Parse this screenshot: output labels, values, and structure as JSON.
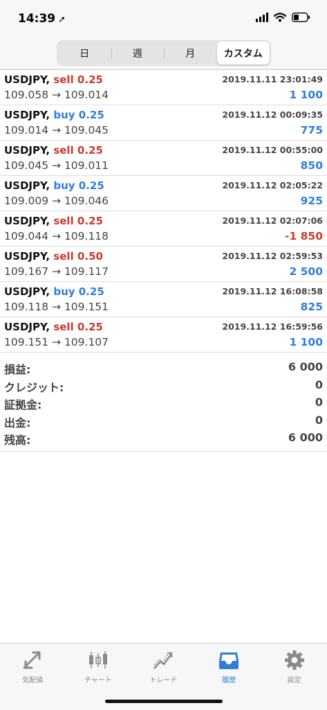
{
  "status_bar": {
    "time": "14:39",
    "location_glyph": "➚"
  },
  "segments": [
    {
      "label": "日",
      "active": false
    },
    {
      "label": "週",
      "active": false
    },
    {
      "label": "月",
      "active": false
    },
    {
      "label": "カスタム",
      "active": true
    }
  ],
  "deals": [
    {
      "symbol": "USDJPY,",
      "side": "sell",
      "side_text": "sell 0.25",
      "time": "2019.11.11 23:01:49",
      "prices": "109.058 → 109.014",
      "profit": "1 100",
      "profit_sign": "pos"
    },
    {
      "symbol": "USDJPY,",
      "side": "buy",
      "side_text": "buy 0.25",
      "time": "2019.11.12 00:09:35",
      "prices": "109.014 → 109.045",
      "profit": "775",
      "profit_sign": "pos"
    },
    {
      "symbol": "USDJPY,",
      "side": "sell",
      "side_text": "sell 0.25",
      "time": "2019.11.12 00:55:00",
      "prices": "109.045 → 109.011",
      "profit": "850",
      "profit_sign": "pos"
    },
    {
      "symbol": "USDJPY,",
      "side": "buy",
      "side_text": "buy 0.25",
      "time": "2019.11.12 02:05:22",
      "prices": "109.009 → 109.046",
      "profit": "925",
      "profit_sign": "pos"
    },
    {
      "symbol": "USDJPY,",
      "side": "sell",
      "side_text": "sell 0.25",
      "time": "2019.11.12 02:07:06",
      "prices": "109.044 → 109.118",
      "profit": "-1 850",
      "profit_sign": "neg"
    },
    {
      "symbol": "USDJPY,",
      "side": "sell",
      "side_text": "sell 0.50",
      "time": "2019.11.12 02:59:53",
      "prices": "109.167 → 109.117",
      "profit": "2 500",
      "profit_sign": "pos"
    },
    {
      "symbol": "USDJPY,",
      "side": "buy",
      "side_text": "buy 0.25",
      "time": "2019.11.12 16:08:58",
      "prices": "109.118 → 109.151",
      "profit": "825",
      "profit_sign": "pos"
    },
    {
      "symbol": "USDJPY,",
      "side": "sell",
      "side_text": "sell 0.25",
      "time": "2019.11.12 16:59:56",
      "prices": "109.151 → 109.107",
      "profit": "1 100",
      "profit_sign": "pos"
    }
  ],
  "summary": [
    {
      "label": "損益:",
      "value": "6 000"
    },
    {
      "label": "クレジット:",
      "value": "0"
    },
    {
      "label": "証拠金:",
      "value": "0"
    },
    {
      "label": "出金:",
      "value": "0"
    },
    {
      "label": "残高:",
      "value": "6 000"
    }
  ],
  "tabbar": [
    {
      "label": "気配値",
      "icon": "quotes-icon",
      "active": false
    },
    {
      "label": "チャート",
      "icon": "chart-icon",
      "active": false
    },
    {
      "label": "トレード",
      "icon": "trade-icon",
      "active": false
    },
    {
      "label": "履歴",
      "icon": "history-icon",
      "active": true
    },
    {
      "label": "設定",
      "icon": "settings-icon",
      "active": false
    }
  ],
  "colors": {
    "sell": "#cc3a2b",
    "buy": "#2f7dd9",
    "active_tab": "#2f7dd9"
  }
}
